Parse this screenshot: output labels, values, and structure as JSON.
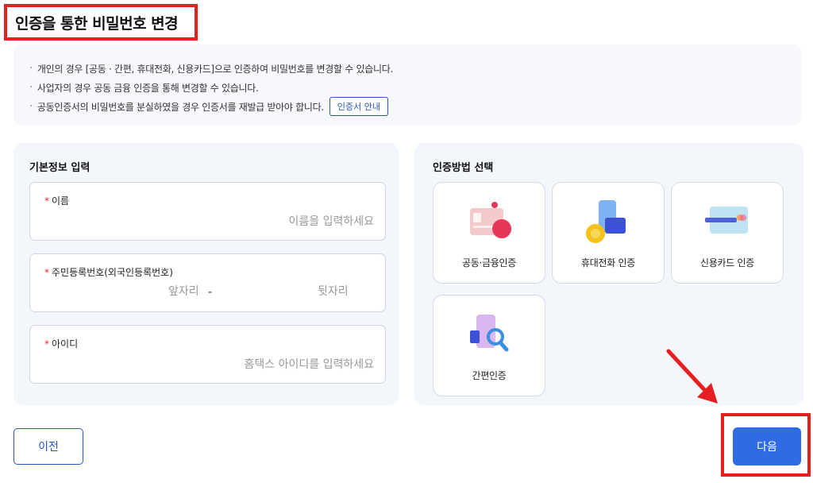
{
  "page_title": "인증을 통한 비밀번호 변경",
  "notice": {
    "items": [
      "개인의 경우 [공동 · 간편, 휴대전화, 신용카드]으로 인증하여 비밀번호를 변경할 수 있습니다.",
      "사업자의 경우  공동  금융 인증을 통해 변경할 수 있습니다.",
      "공동인증서의 비밀번호를 분실하였을 경우 인증서를 재발급 받아야 합니다."
    ],
    "guide_button": "인증서 안내"
  },
  "basic_info": {
    "heading": "기본정보 입력",
    "name": {
      "required_mark": "*",
      "label": "이름",
      "placeholder": "이름을 입력하세요"
    },
    "rrn": {
      "required_mark": "*",
      "label": "주민등록번호(외국인등록번호)",
      "front_placeholder": "앞자리",
      "separator": "-",
      "back_placeholder": "뒷자리"
    },
    "userid": {
      "required_mark": "*",
      "label": "아이디",
      "placeholder": "홈택스 아이디를 입력하세요"
    }
  },
  "auth_method": {
    "heading": "인증방법 선택",
    "methods": [
      {
        "label": "공동·금융인증",
        "icon": "certificate-icon"
      },
      {
        "label": "휴대전화 인증",
        "icon": "mobile-phone-icon"
      },
      {
        "label": "신용카드 인증",
        "icon": "credit-card-icon"
      },
      {
        "label": "간편인증",
        "icon": "simple-auth-icon"
      }
    ]
  },
  "buttons": {
    "prev": "이전",
    "next": "다음"
  },
  "colors": {
    "accent": "#2f6be5",
    "highlight": "#e51f1f",
    "outline": "#2b55b8"
  }
}
